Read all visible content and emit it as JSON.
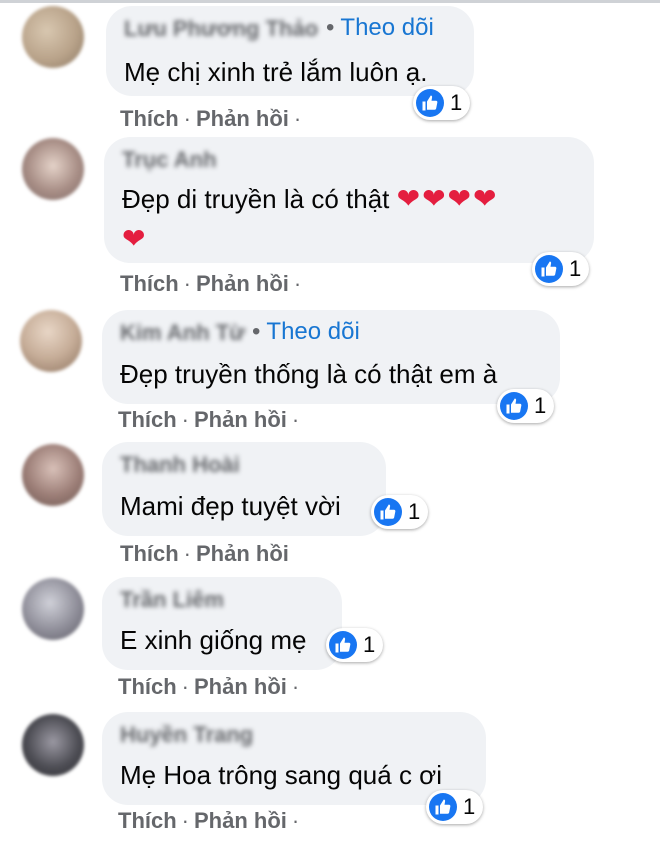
{
  "comments": [
    {
      "name": "Lưu Phương Thảo",
      "follow": "Theo dõi",
      "text": "Mẹ chị xinh trẻ lắm luôn ạ.",
      "likes": "1",
      "like_action": "Thích",
      "reply_action": "Phản hồi",
      "avatar_color": "#b9a38a"
    },
    {
      "name": "Trục Anh",
      "text_line1": "Đẹp di truyền là có thật",
      "hearts_line1": "❤❤❤❤",
      "hearts_line2": "❤",
      "likes": "1",
      "like_action": "Thích",
      "reply_action": "Phản hồi",
      "avatar_color": "#a88e86"
    },
    {
      "name": "Kim Anh Từ",
      "follow": "Theo dõi",
      "text": "Đẹp truyền thống là có thật em à",
      "likes": "1",
      "like_action": "Thích",
      "reply_action": "Phản hồi",
      "avatar_color": "#c6ad98"
    },
    {
      "name": "Thanh Hoài",
      "text": "Mami đẹp tuyệt vời",
      "likes": "1",
      "like_action": "Thích",
      "reply_action": "Phản hồi",
      "avatar_color": "#9c7e77"
    },
    {
      "name": "Trần Liêm",
      "text": "E xinh giống mẹ",
      "likes": "1",
      "like_action": "Thích",
      "reply_action": "Phản hồi",
      "avatar_color": "#8f8e99"
    },
    {
      "name": "Huyền Trang",
      "text": "Mẹ Hoa trông sang quá c ơi",
      "likes": "1",
      "like_action": "Thích",
      "reply_action": "Phản hồi",
      "avatar_color": "#4e4e55"
    }
  ],
  "colors": {
    "bubble": "#f0f2f5",
    "link_blue": "#1876d2",
    "like_blue": "#1876f2",
    "meta_gray": "#65676b",
    "heart_red": "#e41e3f"
  }
}
